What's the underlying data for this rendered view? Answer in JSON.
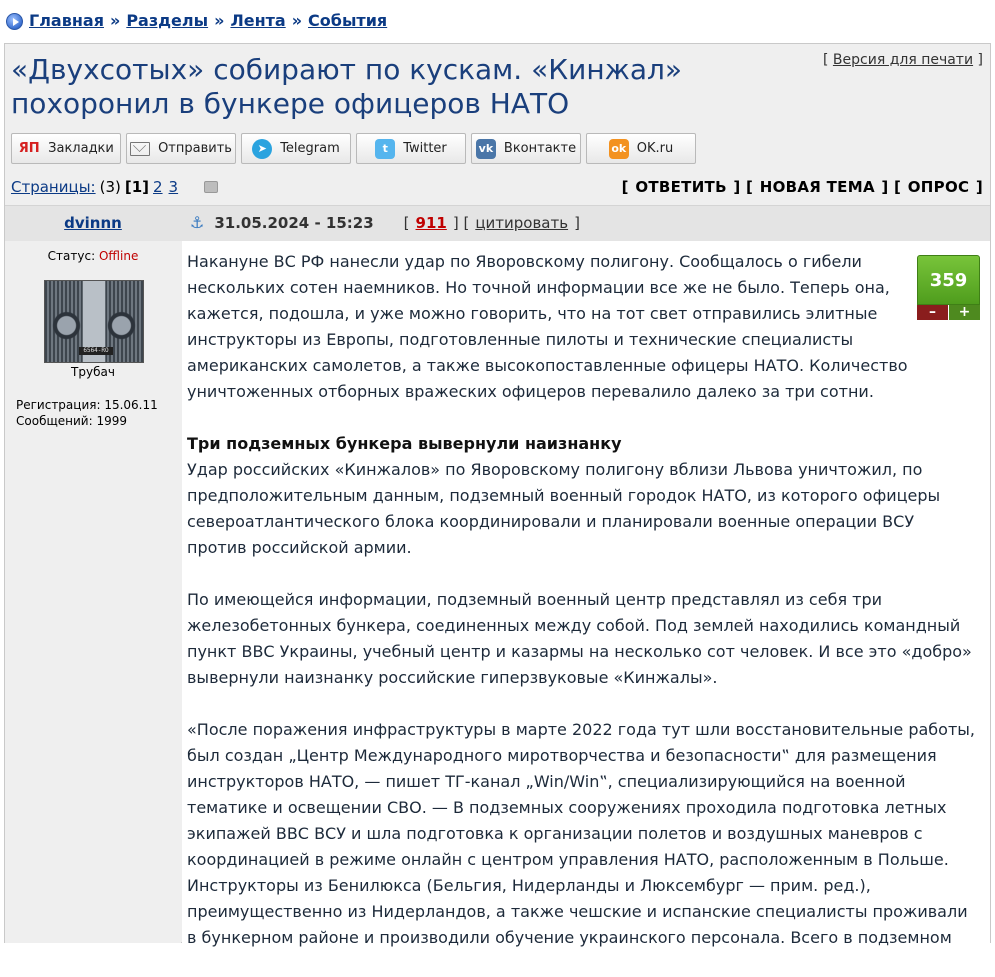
{
  "breadcrumb": {
    "items": [
      "Главная",
      "Разделы",
      "Лента",
      "События"
    ],
    "separator": "»"
  },
  "topic": {
    "title": "«Двухсотых» собирают по кускам. «Кинжал» похоронил в бункере офицеров НАТО",
    "print_open": "[",
    "print_label": "Версия для печати",
    "print_close": "]"
  },
  "share": [
    {
      "label": "Закладки",
      "icon": "yandex-bookmarks-icon",
      "glyph": "ЯП"
    },
    {
      "label": "Отправить",
      "icon": "mail-icon",
      "glyph": ""
    },
    {
      "label": "Telegram",
      "icon": "telegram-icon",
      "glyph": "➤"
    },
    {
      "label": "Twitter",
      "icon": "twitter-icon",
      "glyph": "t"
    },
    {
      "label": "Вконтакте",
      "icon": "vk-icon",
      "glyph": "vk"
    },
    {
      "label": "OK.ru",
      "icon": "ok-icon",
      "glyph": "ok"
    }
  ],
  "pages": {
    "label": "Страницы:",
    "count": "(3)",
    "current": "[1]",
    "links": [
      "2",
      "3"
    ]
  },
  "actions": {
    "reply": "ОТВЕТИТЬ",
    "new_topic": "НОВАЯ ТЕМА",
    "poll": "ОПРОС"
  },
  "post": {
    "author": "dvinnn",
    "date": "31.05.2024 - 15:23",
    "number": "911",
    "quote_label": "цитировать",
    "status_label": "Статус:",
    "status_value": "Offline",
    "rank": "Трубач",
    "registration": "Регистрация: 15.06.11",
    "messages": "Сообщений: 1999",
    "avatar_plate": "6564-RO",
    "rating": {
      "score": "359",
      "minus": "–",
      "plus": "+"
    },
    "paragraphs": [
      "Накануне ВС РФ нанесли удар по Яворовскому полигону. Сообщалось о гибели нескольких сотен наемников. Но точной информации все же не было. Теперь она, кажется, подошла, и уже можно говорить, что на тот свет отправились элитные инструкторы из Европы, подготовленные пилоты и технические специалисты американских самолетов, а также высокопоставленные офицеры НАТО. Количество уничтоженных отборных вражеских офицеров перевалило далеко за три сотни."
    ],
    "heading": "Три подземных бункера вывернули наизнанку",
    "paragraph_2": "Удар российских «Кинжалов» по Яворовскому полигону вблизи Львова уничтожил, по предположительным данным, подземный военный городок НАТО, из которого офицеры североатлантического блока координировали и планировали военные операции ВСУ против российской армии.",
    "paragraph_3": "По имеющейся информации, подземный военный центр представлял из себя три железобетонных бункера, соединенных между собой. Под землей находились командный пункт ВВС Украины, учебный центр и казармы на несколько сот человек. И все это «добро» вывернули наизнанку российские гиперзвуковые «Кинжалы».",
    "paragraph_4": "«После поражения инфраструктуры в марте 2022 года тут шли восстановительные работы, был создан „Центр Международного миротворчества и безопасности‟ для размещения инструкторов НАТО, — пишет ТГ-канал „Win/Win‟, специализирующийся на военной тематике и освещении СВО. — В подземных сооружениях проходила подготовка летных экипажей ВВС ВСУ и шла подготовка к организации полетов и воздушных маневров с координацией в режиме онлайн с центром управления НАТО, расположенным в Польше. Инструкторы из Бенилюкса (Бельгия, Нидерланды и Люксембург — прим. ред.), преимущественно из Нидерландов, а также чешские и испанские специалисты проживали в бункерном районе и производили обучение украинского персонала. Всего в подземном"
  }
}
